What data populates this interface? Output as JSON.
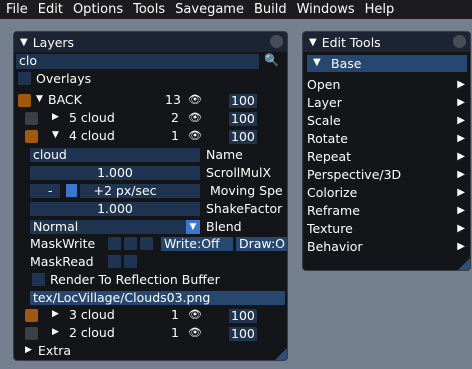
{
  "menu": [
    "File",
    "Edit",
    "Options",
    "Tools",
    "Savegame",
    "Build",
    "Windows",
    "Help"
  ],
  "layers": {
    "title": "Layers",
    "search_value": "clo",
    "search_icon": "search-icon",
    "overlays_label": "Overlays",
    "rows": [
      {
        "name": "BACK",
        "count": "13",
        "value": "100",
        "color": "#a0590e",
        "expanded": true
      },
      {
        "name": "5 cloud",
        "count": "2",
        "value": "100",
        "color": "#3c3f44",
        "expanded": false
      },
      {
        "name": "4 cloud",
        "count": "1",
        "value": "100",
        "color": "#a0590e",
        "expanded": true
      }
    ],
    "props": {
      "name_value": "cloud",
      "name_label": "Name",
      "scroll_value": "1.000",
      "scroll_label": "ScrollMulX",
      "minus": "-",
      "moving_value": "+2 px/sec",
      "moving_label": "Moving Spe",
      "shake_value": "1.000",
      "shake_label": "ShakeFactor",
      "blend_value": "Normal",
      "blend_label": "Blend",
      "maskwrite_label": "MaskWrite",
      "write_label": "Write:Off",
      "draw_label": "Draw:O",
      "maskread_label": "MaskRead",
      "reflection_label": "Render To Reflection Buffer",
      "texture_path": "tex/LocVillage/Clouds03.png"
    },
    "rows2": [
      {
        "name": "3 cloud",
        "count": "1",
        "value": "100",
        "color": "#a0590e"
      },
      {
        "name": "2 cloud",
        "count": "1",
        "value": "100",
        "color": "#3c3f44"
      }
    ],
    "extra_label": "Extra"
  },
  "edit_tools": {
    "title": "Edit Tools",
    "base_label": "Base",
    "items": [
      "Open",
      "Layer",
      "Scale",
      "Rotate",
      "Repeat",
      "Perspective/3D",
      "Colorize",
      "Reframe",
      "Texture",
      "Behavior"
    ]
  },
  "colors": {
    "accent": "#26476f",
    "field": "#1f3451",
    "background": "#74808f"
  }
}
